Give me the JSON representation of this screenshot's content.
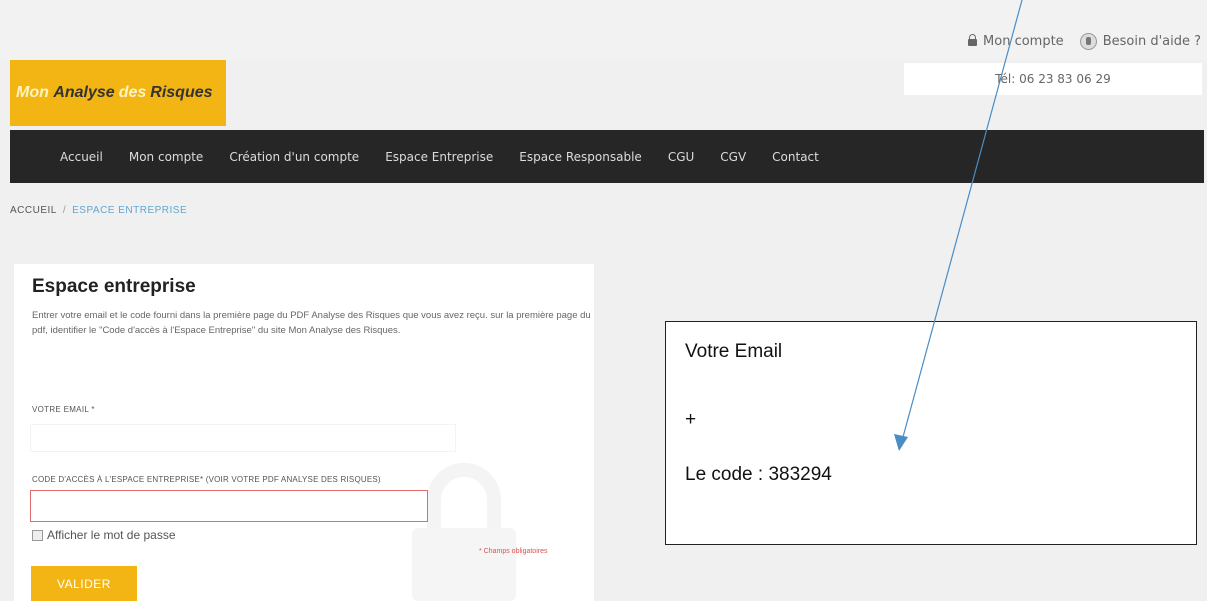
{
  "header": {
    "account_link": "Mon compte",
    "help_link": "Besoin d'aide ?",
    "phone": "Tél: 06 23 83 06 29"
  },
  "logo": {
    "part1": "Mon",
    "part2": "Analyse",
    "part3": "des",
    "part4": "Risques"
  },
  "nav": {
    "items": [
      "Accueil",
      "Mon compte",
      "Création d'un compte",
      "Espace Entreprise",
      "Espace Responsable",
      "CGU",
      "CGV",
      "Contact"
    ]
  },
  "breadcrumb": {
    "home": "ACCUEIL",
    "separator": "/",
    "current": "ESPACE ENTREPRISE"
  },
  "form": {
    "title": "Espace entreprise",
    "description": "Entrer votre email et le code fourni dans la première page du PDF Analyse des Risques que vous avez reçu. sur la première page du pdf, identifier le \"Code d'accès à l'Espace Entreprise\" du site Mon Analyse des Risques.",
    "email_label": "VOTRE EMAIL *",
    "code_label": "CODE D'ACCÈS À L'ESPACE ENTREPRISE* (VOIR VOTRE PDF ANALYSE DES RISQUES)",
    "show_password": "Afficher le mot de passe",
    "required_note": "* Champs obligatoires",
    "submit": "VALIDER"
  },
  "callout": {
    "line1": "Votre Email",
    "line2": "+",
    "line3": "Le code : 383294"
  },
  "colors": {
    "accent": "#f2b514",
    "nav_bg": "#262626",
    "link": "#5fa7d0",
    "error_border": "#e06a6a"
  }
}
